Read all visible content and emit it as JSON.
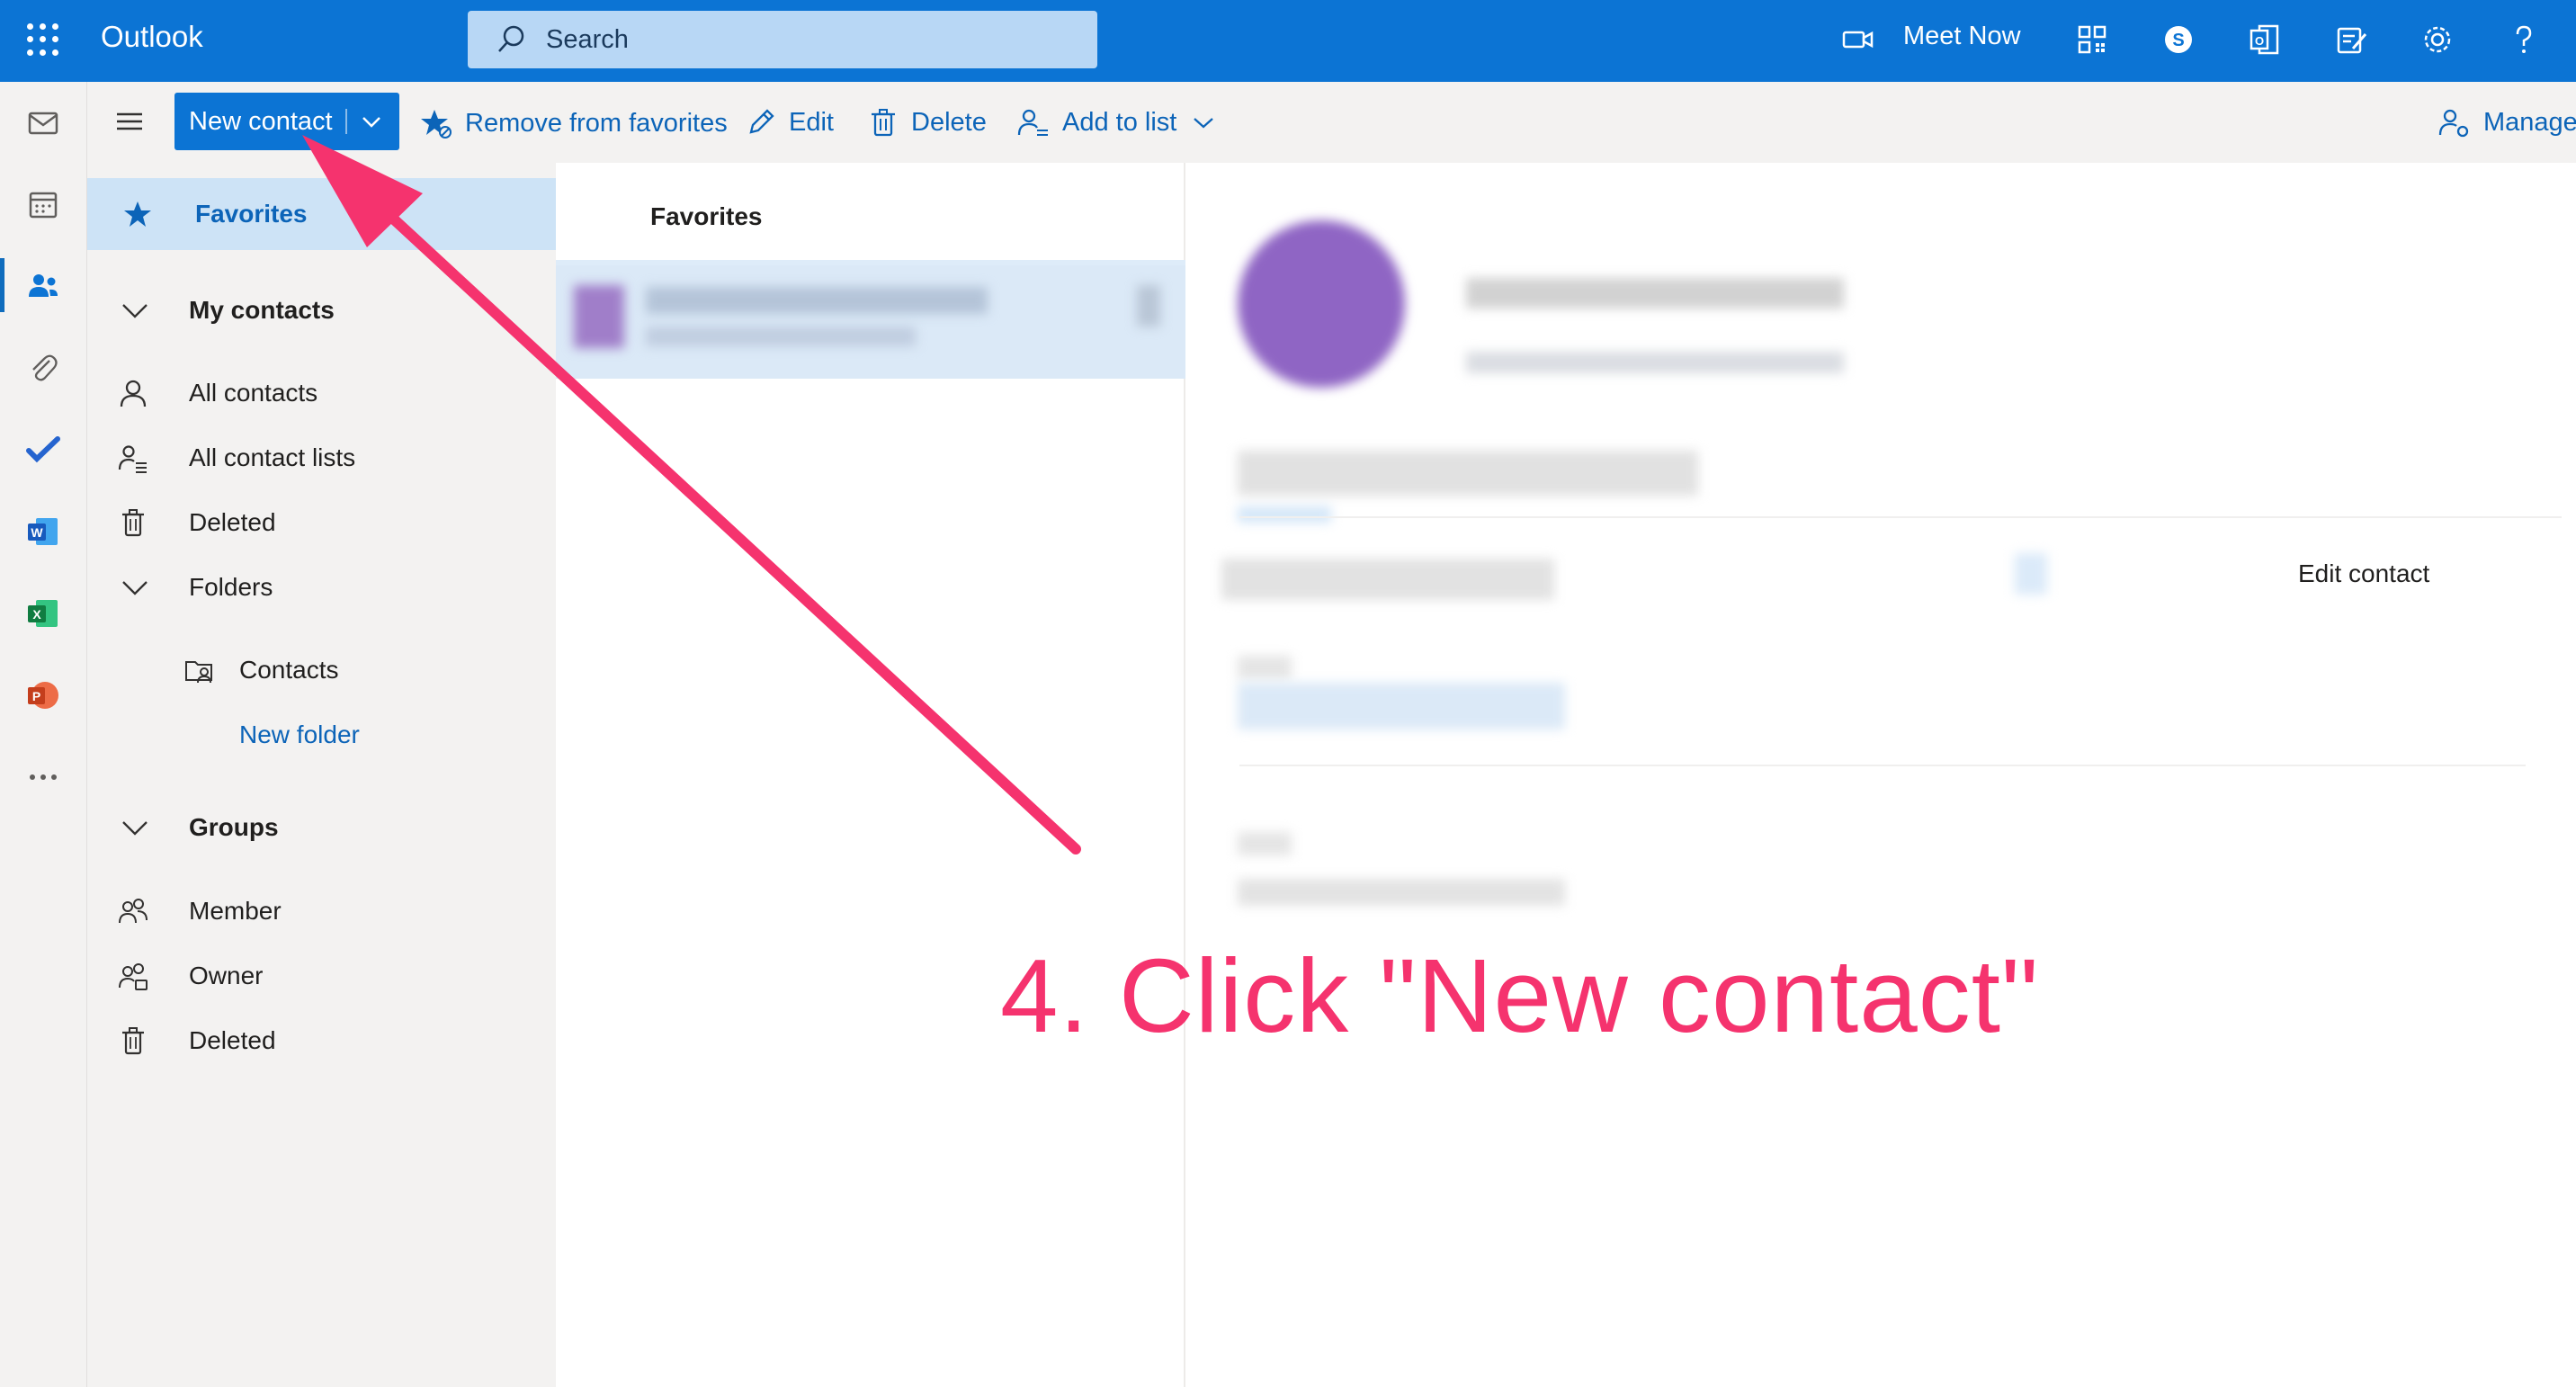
{
  "app": {
    "name": "Outlook"
  },
  "search": {
    "placeholder": "Search"
  },
  "topbar": {
    "meet_now": "Meet Now",
    "icons": [
      "video-icon",
      "qr-code-icon",
      "skype-icon",
      "office-icon",
      "feedback-icon",
      "gear-icon",
      "help-icon"
    ]
  },
  "rail": {
    "items": [
      "mail-icon",
      "calendar-icon",
      "people-icon",
      "attachment-icon",
      "todo-icon",
      "word-icon",
      "excel-icon",
      "powerpoint-icon",
      "more-icon"
    ]
  },
  "toolbar": {
    "new_contact": "New contact",
    "remove_favorites": "Remove from favorites",
    "edit": "Edit",
    "delete": "Delete",
    "add_to_list": "Add to list",
    "manage": "Manage"
  },
  "folders": {
    "favorites": "Favorites",
    "my_contacts": "My contacts",
    "all_contacts": "All contacts",
    "all_contact_lists": "All contact lists",
    "deleted": "Deleted",
    "folders": "Folders",
    "contacts": "Contacts",
    "new_folder": "New folder",
    "groups": "Groups",
    "member": "Member",
    "owner": "Owner",
    "groups_deleted": "Deleted"
  },
  "list": {
    "header": "Favorites"
  },
  "reading": {
    "edit_contact": "Edit contact"
  },
  "annotation": {
    "text": "4. Click \"New contact\"",
    "color": "#f5336e"
  },
  "colors": {
    "accent": "#0c74d4",
    "annotation": "#f5336e",
    "selected": "#cde3f6"
  }
}
